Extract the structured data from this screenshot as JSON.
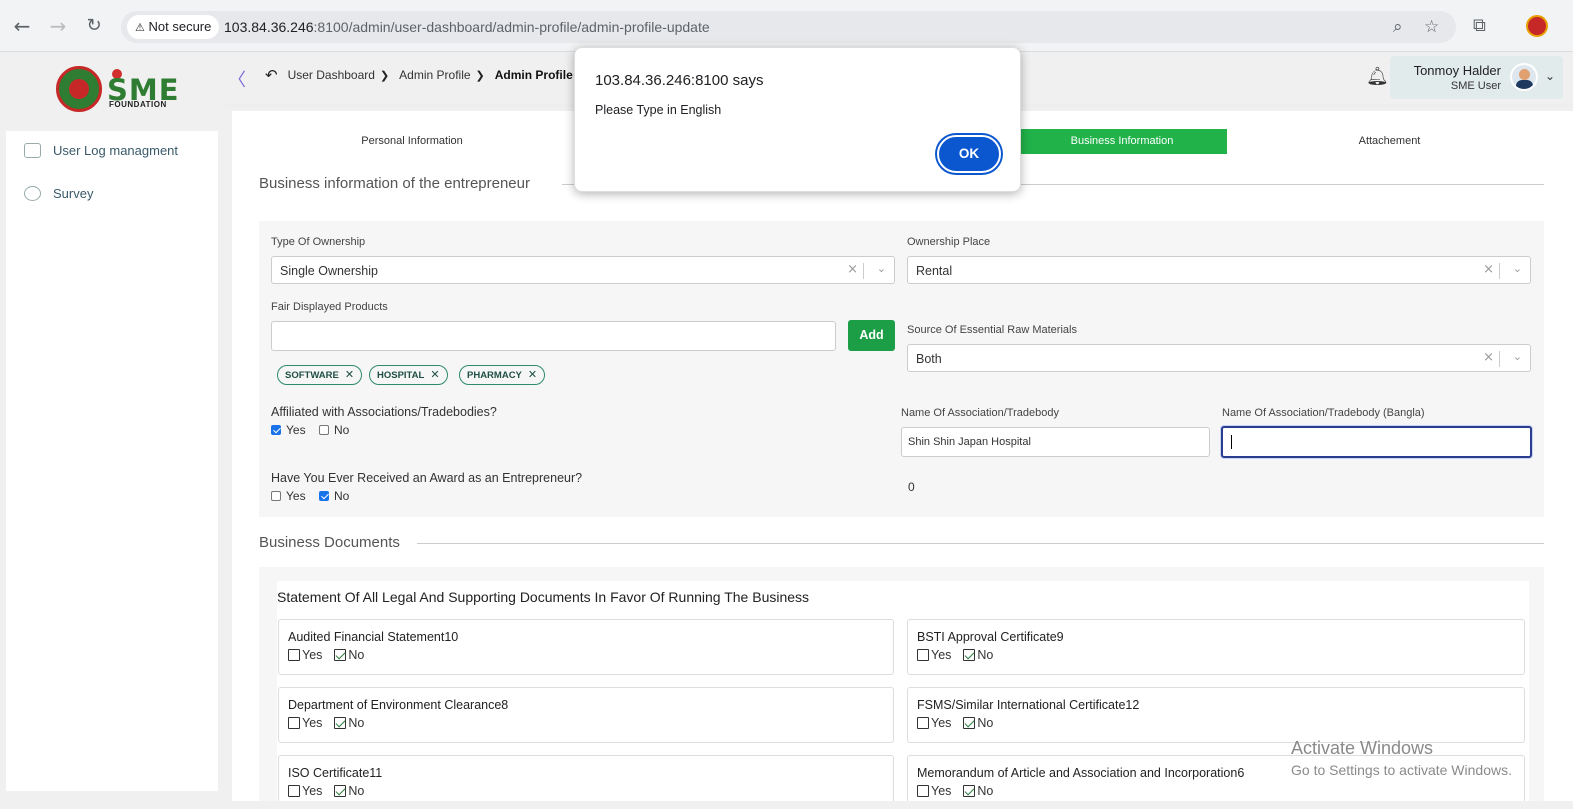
{
  "browser": {
    "not_secure": "Not secure",
    "url_host": "103.84.36.246",
    "url_rest": ":8100/admin/user-dashboard/admin-profile/admin-profile-update",
    "icons": {
      "back": "arrow-left-icon",
      "forward": "arrow-right-icon",
      "reload": "reload-icon",
      "zoom": "zoom-icon",
      "star": "star-icon",
      "extensions": "puzzle-icon"
    }
  },
  "sidebar": {
    "logo_text": "SME",
    "logo_sub": "FOUNDATION",
    "items": [
      {
        "label": "User Log managment",
        "icon": "log-icon"
      },
      {
        "label": "Survey",
        "icon": "pie-chart-icon"
      }
    ]
  },
  "breadcrumb": [
    "User Dashboard",
    "Admin Profile",
    "Admin Profile Upda"
  ],
  "user": {
    "name": "Tonmoy Halder",
    "role": "SME User"
  },
  "tabs": [
    "Personal Information",
    "Business Information",
    "Attachement"
  ],
  "business": {
    "section_title": "Business information of the entrepreneur",
    "ownership_type_label": "Type Of Ownership",
    "ownership_type_value": "Single Ownership",
    "ownership_place_label": "Ownership Place",
    "ownership_place_value": "Rental",
    "fair_products_label": "Fair Displayed Products",
    "add_label": "Add",
    "chips": [
      "SOFTWARE",
      "HOSPITAL",
      "PHARMACY"
    ],
    "raw_materials_label": "Source Of Essential Raw Materials",
    "raw_materials_value": "Both",
    "affiliated_label": "Affiliated with Associations/Tradebodies?",
    "yes": "Yes",
    "no": "No",
    "assoc_name_label": "Name Of Association/Tradebody",
    "assoc_name_value": "Shin Shin Japan Hospital",
    "assoc_bangla_label": "Name Of Association/Tradebody (Bangla)",
    "award_label": "Have You Ever Received an Award as an Entrepreneur?",
    "award_count": "0"
  },
  "documents": {
    "section_title": "Business Documents",
    "statement": "Statement Of All Legal And Supporting Documents In Favor Of Running The Business",
    "items": [
      "Audited Financial Statement10",
      "BSTI Approval Certificate9",
      "Department of Environment Clearance8",
      "FSMS/Similar International Certificate12",
      "ISO Certificate11",
      "Memorandum of Article and Association and Incorporation6"
    ]
  },
  "dialog": {
    "title": "103.84.36.246:8100 says",
    "message": "Please Type in English",
    "ok": "OK"
  },
  "watermark": {
    "line1": "Activate Windows",
    "line2": "Go to Settings to activate Windows."
  }
}
